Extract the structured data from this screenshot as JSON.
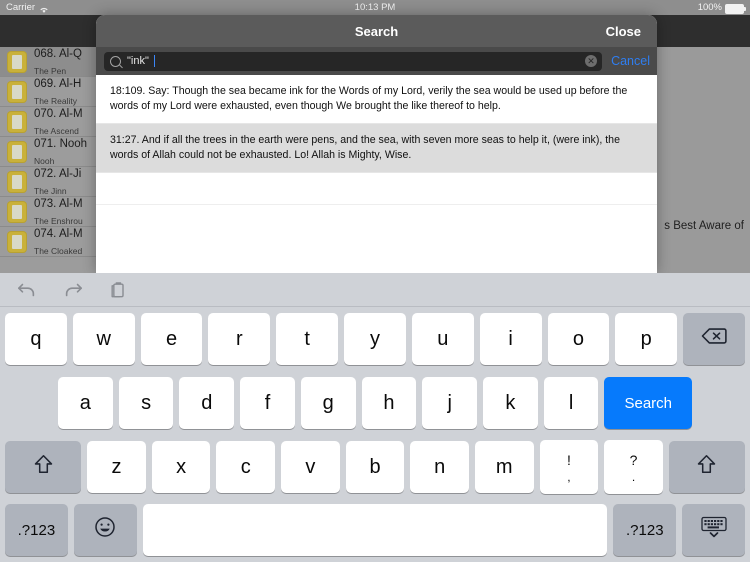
{
  "status_bar": {
    "carrier": "Carrier",
    "wifi_icon": "wifi-icon",
    "time": "10:13 PM",
    "battery_percent": "100%",
    "battery_icon": "battery-full-icon"
  },
  "background_app": {
    "right_partial_text": "s Best Aware of",
    "surah_list": [
      {
        "number_name": "068. Al-Q",
        "subtitle": "The Pen",
        "selected": true
      },
      {
        "number_name": "069. Al-H",
        "subtitle": "The Reality",
        "selected": false
      },
      {
        "number_name": "070. Al-M",
        "subtitle": "The Ascend",
        "selected": false
      },
      {
        "number_name": "071. Nooh",
        "subtitle": "Nooh",
        "selected": false
      },
      {
        "number_name": "072. Al-Ji",
        "subtitle": "The Jinn",
        "selected": false
      },
      {
        "number_name": "073. Al-M",
        "subtitle": "The Enshrou",
        "selected": false
      },
      {
        "number_name": "074. Al-M",
        "subtitle": "The Cloaked",
        "selected": false
      }
    ]
  },
  "modal": {
    "title": "Search",
    "close_label": "Close",
    "search": {
      "value": "\"ink\"",
      "placeholder": "Search",
      "search_icon": "search-icon",
      "clear_icon": "clear-circle-icon",
      "clear_glyph": "✕",
      "cancel_label": "Cancel"
    },
    "results": [
      {
        "text": "18:109. Say: Though the sea became ink for the Words of my Lord, verily the sea would be used up before the words of my Lord were exhausted, even though We brought the like thereof to help."
      },
      {
        "text": "31:27. And if all the trees in the earth were pens, and the sea, with seven more seas to help it, (were ink), the words of Allah could not be exhausted. Lo! Allah is Mighty, Wise."
      }
    ]
  },
  "keyboard": {
    "toolbar": {
      "undo_icon": "undo-icon",
      "redo_icon": "redo-icon",
      "paste_icon": "paste-icon"
    },
    "row1": [
      "q",
      "w",
      "e",
      "r",
      "t",
      "y",
      "u",
      "i",
      "o",
      "p"
    ],
    "backspace_icon": "backspace-icon",
    "row2": [
      "a",
      "s",
      "d",
      "f",
      "g",
      "h",
      "j",
      "k",
      "l"
    ],
    "search_key_label": "Search",
    "row3": [
      "z",
      "x",
      "c",
      "v",
      "b",
      "n",
      "m"
    ],
    "punct_key_1": {
      "top": "!",
      "bottom": ","
    },
    "punct_key_2": {
      "top": "?",
      "bottom": "."
    },
    "shift_left_icon": "shift-icon",
    "shift_right_icon": "shift-icon",
    "numeric_left_label": ".?123",
    "numeric_right_label": ".?123",
    "emoji_icon": "emoji-icon",
    "space_label": "",
    "hide_keyboard_icon": "hide-keyboard-icon"
  },
  "colors": {
    "accent_blue": "#067afc",
    "cancel_blue": "#2f7ef0",
    "modal_header": "#5b5b5b",
    "keyboard_bg": "#cfd2d7"
  }
}
